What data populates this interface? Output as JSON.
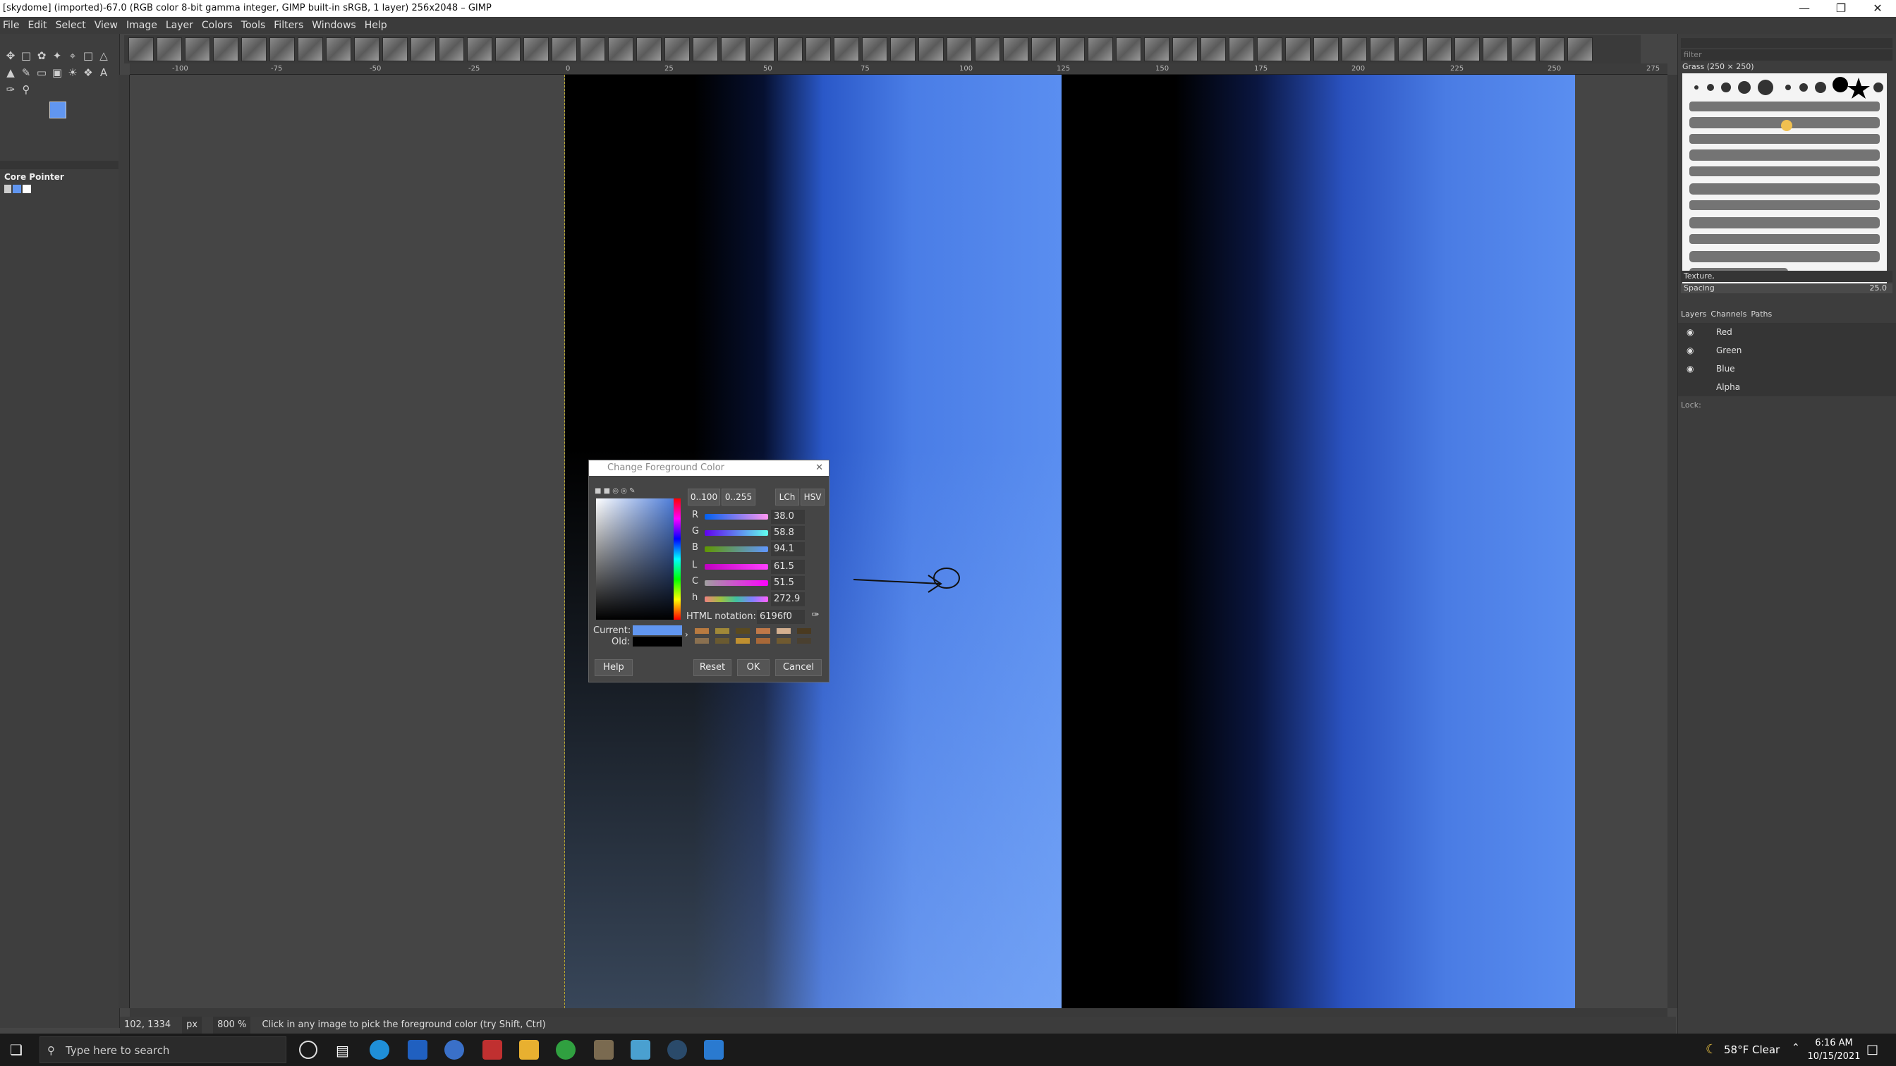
{
  "window": {
    "title": "[skydome] (imported)-67.0 (RGB color 8-bit gamma integer, GIMP built-in sRGB, 1 layer) 256x2048 – GIMP"
  },
  "menu": [
    "File",
    "Edit",
    "Select",
    "View",
    "Image",
    "Layer",
    "Colors",
    "Tools",
    "Filters",
    "Windows",
    "Help"
  ],
  "toolbox": {
    "device_label": "Core Pointer",
    "fg_color": "#6196f0",
    "bg_color": "#000000"
  },
  "ruler": {
    "ticks": [
      "-100",
      "-75",
      "-50",
      "-25",
      "0",
      "25",
      "50",
      "75",
      "100",
      "125",
      "150",
      "175",
      "200",
      "225",
      "250",
      "275"
    ]
  },
  "statusbar": {
    "coords": "102, 1334",
    "unit": "px",
    "zoom": "800 %",
    "message": "Click in any image to pick the foreground color (try Shift, Ctrl)"
  },
  "right_panel": {
    "filter_placeholder": "filter",
    "brush_name": "Grass (250 × 250)",
    "tag_value": "Texture,",
    "spacing_label": "Spacing",
    "spacing_value": "25.0",
    "tabs": [
      "Layers",
      "Channels",
      "Paths"
    ],
    "channels": [
      "Red",
      "Green",
      "Blue",
      "Alpha"
    ],
    "lock_label": "Lock:"
  },
  "dialog": {
    "title": "Change Foreground Color",
    "range_buttons": [
      "0..100",
      "0..255"
    ],
    "model_buttons": [
      "LCh",
      "HSV"
    ],
    "sliders": [
      {
        "label": "R",
        "value": "38.0"
      },
      {
        "label": "G",
        "value": "58.8"
      },
      {
        "label": "B",
        "value": "94.1"
      },
      {
        "label": "L",
        "value": "61.5"
      },
      {
        "label": "C",
        "value": "51.5"
      },
      {
        "label": "h",
        "value": "272.9"
      }
    ],
    "html_label": "HTML notation:",
    "html_value": "6196f0",
    "current_label": "Current:",
    "old_label": "Old:",
    "current_color": "#6196f0",
    "old_color": "#000000",
    "history_colors": [
      "#b87a40",
      "#a08838",
      "#5a4a20",
      "#c07848",
      "#d4b090",
      "#4a3a20",
      "#8a7050",
      "#6a5a30",
      "#c09030",
      "#a86838",
      "#705a30",
      "#4a4030"
    ],
    "buttons": {
      "help": "Help",
      "reset": "Reset",
      "ok": "OK",
      "cancel": "Cancel"
    }
  },
  "taskbar": {
    "search_placeholder": "Type here to search",
    "weather": "58°F  Clear",
    "time": "6:16 AM",
    "date": "10/15/2021"
  }
}
